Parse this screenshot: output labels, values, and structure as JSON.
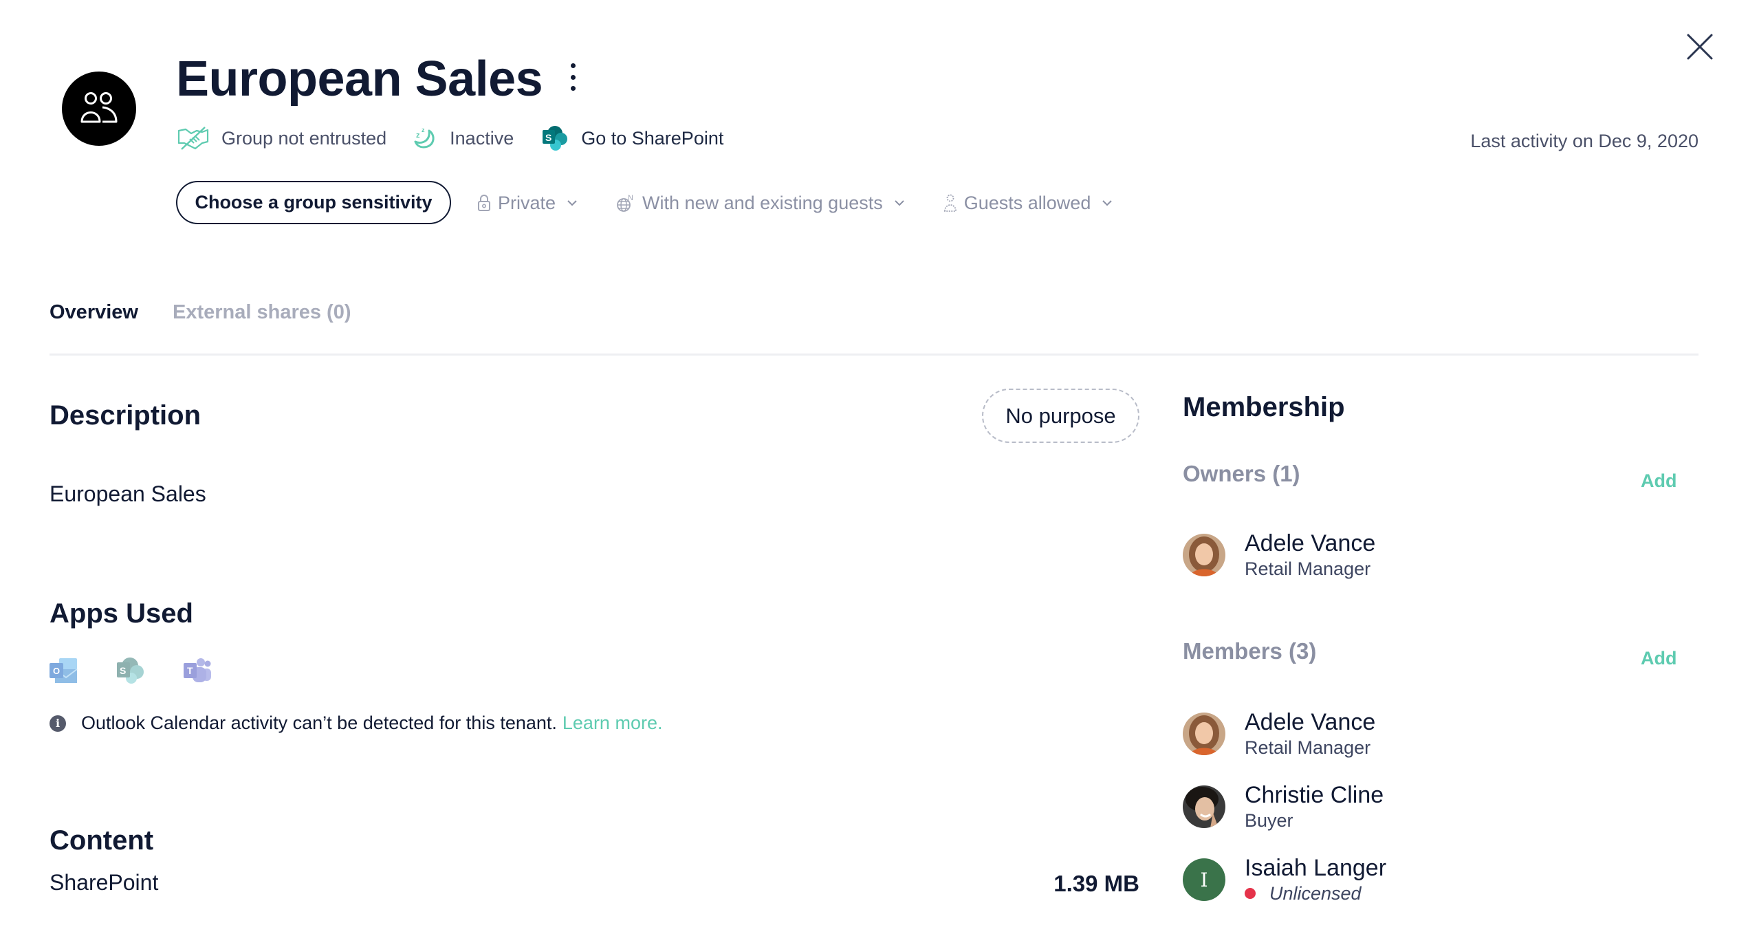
{
  "header": {
    "title": "European Sales",
    "status": {
      "entrusted": "Group not entrusted",
      "activity": "Inactive",
      "sharepoint_link": "Go to SharePoint"
    },
    "last_activity": "Last activity on Dec 9, 2020",
    "sensitivity_button": "Choose a group sensitivity",
    "dropdowns": {
      "privacy": "Private",
      "sharing": "With new and existing guests",
      "guests": "Guests allowed"
    }
  },
  "tabs": [
    {
      "label": "Overview",
      "active": true
    },
    {
      "label": "External shares (0)",
      "active": false
    }
  ],
  "description": {
    "heading": "Description",
    "purpose_pill": "No purpose",
    "text": "European Sales"
  },
  "apps_used": {
    "heading": "Apps Used",
    "apps": [
      "Outlook",
      "SharePoint",
      "Teams"
    ],
    "info_text": "Outlook Calendar activity can’t be detected for this tenant.",
    "learn_more": "Learn more."
  },
  "content": {
    "heading": "Content",
    "items": [
      {
        "name": "SharePoint",
        "size": "1.39 MB"
      }
    ]
  },
  "membership": {
    "heading": "Membership",
    "owners": {
      "label": "Owners (1)",
      "add": "Add",
      "people": [
        {
          "name": "Adele Vance",
          "role": "Retail Manager"
        }
      ]
    },
    "members": {
      "label": "Members (3)",
      "add": "Add",
      "people": [
        {
          "name": "Adele Vance",
          "role": "Retail Manager"
        },
        {
          "name": "Christie Cline",
          "role": "Buyer"
        },
        {
          "name": "Isaiah Langer",
          "role": "Unlicensed",
          "initial": "I",
          "status_color": "#e5334a",
          "avatar_color": "#3a734a"
        }
      ]
    }
  },
  "colors": {
    "accent": "#5ecbb0",
    "text_dark": "#111a33",
    "muted": "#8b90a4"
  }
}
